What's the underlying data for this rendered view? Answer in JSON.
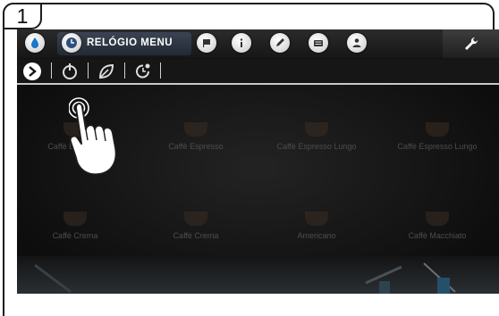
{
  "step": {
    "number": "1"
  },
  "topbar": {
    "menu_title": "RELÓGIO MENU",
    "icons": [
      "water-drop-icon",
      "clock-icon",
      "flag-icon",
      "info-icon",
      "pencil-icon",
      "keyboard-icon",
      "user-icon",
      "wrench-icon"
    ]
  },
  "subbar": {
    "icons": [
      "arrow-right-icon",
      "power-timer-icon",
      "leaf-eco-icon",
      "timer-refresh-icon"
    ]
  },
  "products": [
    {
      "label": "Caffè Espresso"
    },
    {
      "label": "Caffè Espresso"
    },
    {
      "label": "Caffè Espresso Lungo"
    },
    {
      "label": "Caffè Espresso Lungo"
    },
    {
      "label": "Caffè Crema"
    },
    {
      "label": "Caffè Crema"
    },
    {
      "label": "Americano"
    },
    {
      "label": "Caffè Macchiato"
    }
  ],
  "colors": {
    "topbar": "#1f1f1f",
    "accent_blue": "#1a78c8",
    "screen_bg": "#121212",
    "menu_pill": "#2e3644"
  }
}
